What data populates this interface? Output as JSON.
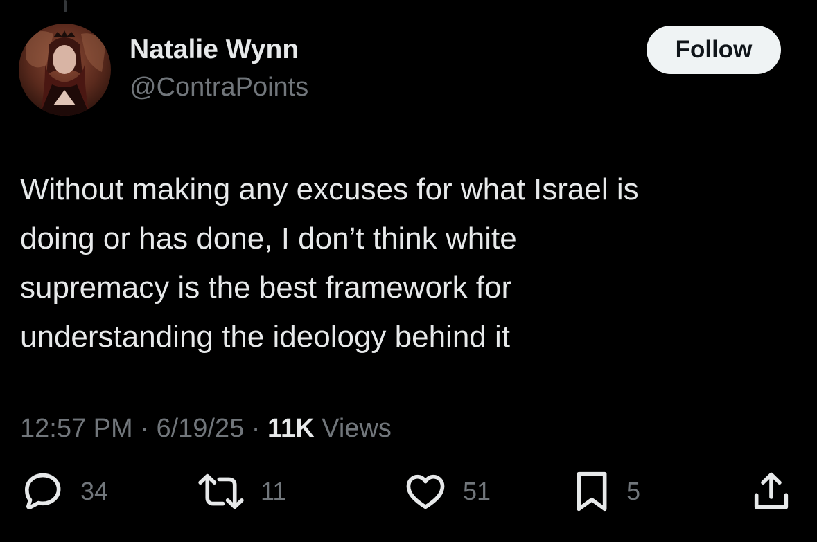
{
  "author": {
    "name": "Natalie Wynn",
    "handle": "@ContraPoints"
  },
  "follow_label": "Follow",
  "tweet": {
    "lines": [
      "Without making any excuses for what Israel is",
      "doing or has done, I don’t think white",
      "supremacy is the best framework for",
      "understanding the ideology behind it"
    ]
  },
  "meta": {
    "time": "12:57 PM",
    "separator": "·",
    "date": "6/19/25",
    "views_count": "11K",
    "views_label": "Views"
  },
  "actions": {
    "replies": "34",
    "reposts": "11",
    "likes": "51",
    "bookmarks": "5"
  },
  "icons": {
    "reply": "reply-icon",
    "repost": "repost-icon",
    "like": "heart-icon",
    "bookmark": "bookmark-icon",
    "share": "share-icon"
  },
  "colors": {
    "background": "#000000",
    "text_primary": "#e7e9ea",
    "text_secondary": "#71767b",
    "follow_button_bg": "#eff3f4",
    "follow_button_text": "#0f1419"
  }
}
